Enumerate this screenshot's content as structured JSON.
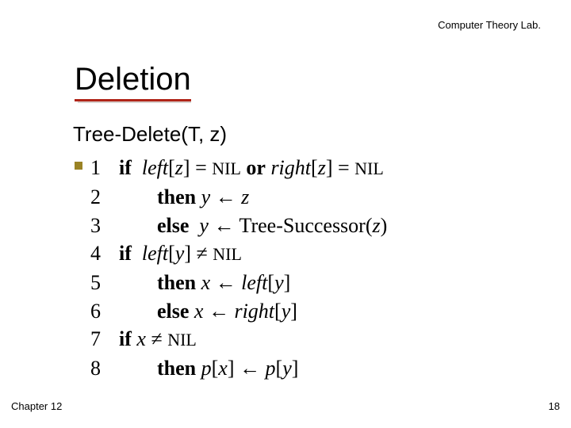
{
  "header": {
    "lab": "Computer Theory Lab."
  },
  "title": "Deletion",
  "subtitle": "Tree-Delete(T, z)",
  "code": {
    "lines": [
      {
        "n": "1",
        "body_html": "<b>if</b>&nbsp; <span class='it'>left</span>[<span class='it'>z</span>] = <span class='nil'>NIL</span> <b>or</b> <span class='it'>right</span>[<span class='it'>z</span>] = <span class='nil'>NIL</span>"
      },
      {
        "n": "2",
        "body_html": "<span class='ind1'></span><b>then</b> <span class='it'>y</span> <span class='arrow'>←</span> <span class='it'>z</span>"
      },
      {
        "n": "3",
        "body_html": "<span class='ind1'></span><b>else</b>&nbsp; <span class='it'>y</span> <span class='arrow'>←</span> Tree-Successor(<span class='it'>z</span>)"
      },
      {
        "n": "4",
        "body_html": "<b>if</b>&nbsp; <span class='it'>left</span>[<span class='it'>y</span>] ≠ <span class='nil'>NIL</span>"
      },
      {
        "n": "5",
        "body_html": "<span class='ind1'></span><b>then</b> <span class='it'>x</span> <span class='arrow'>←</span> <span class='it'>left</span>[<span class='it'>y</span>]"
      },
      {
        "n": "6",
        "body_html": "<span class='ind1'></span><b>else</b> <span class='it'>x</span> <span class='arrow'>←</span> <span class='it'>right</span>[<span class='it'>y</span>]"
      },
      {
        "n": "7",
        "body_html": "<b>if</b> <span class='it'>x</span> ≠ <span class='nil'>NIL</span>"
      },
      {
        "n": "8",
        "body_html": "<span class='ind1'></span><b>then</b> <span class='it'>p</span>[<span class='it'>x</span>] <span class='arrow'>←</span> <span class='it'>p</span>[<span class='it'>y</span>]"
      }
    ]
  },
  "footer": {
    "chapter": "Chapter 12",
    "page": "18"
  }
}
